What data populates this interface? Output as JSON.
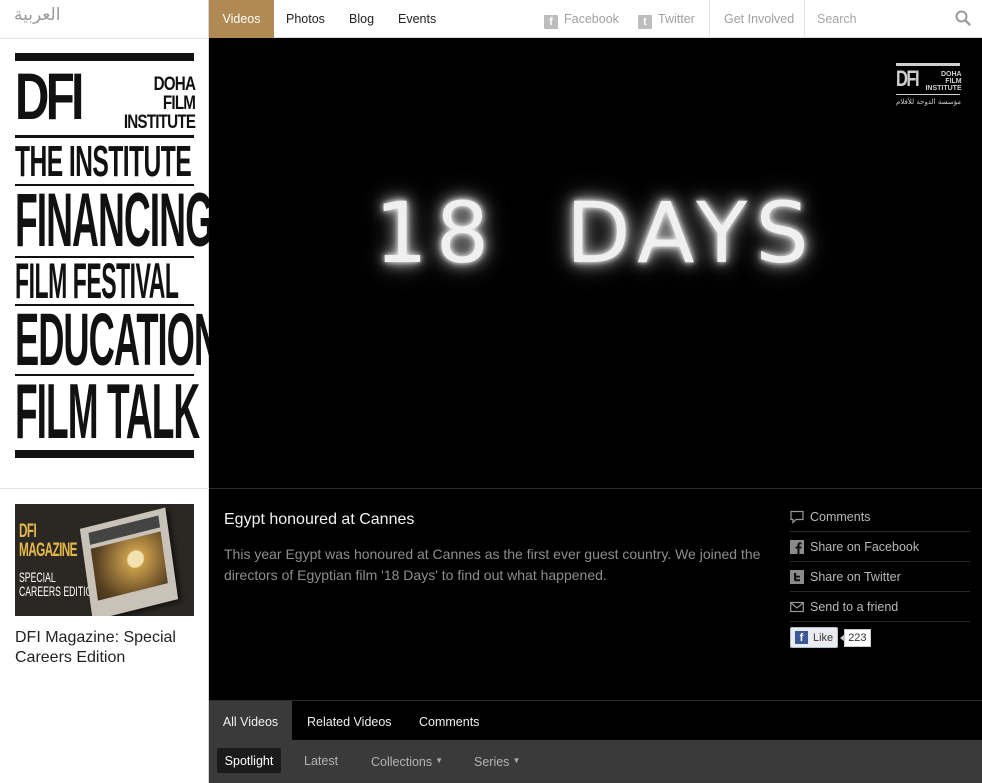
{
  "language_switch": "العربية",
  "logo": {
    "main": "DFI",
    "side_lines": [
      "DOHA",
      "FILM",
      "INSTITUTE"
    ]
  },
  "sidebar_nav": [
    {
      "label": "THE INSTITUTE"
    },
    {
      "label": "FINANCING"
    },
    {
      "label": "FILM FESTIVAL"
    },
    {
      "label": "EDUCATION"
    },
    {
      "label": "FILM TALK"
    }
  ],
  "magazine": {
    "cover_title_line1": "DFI",
    "cover_title_line2": "MAGAZINE",
    "cover_sub_line1": "SPECIAL",
    "cover_sub_line2": "CAREERS EDITION",
    "caption": "DFI Magazine: Special Careers Edition"
  },
  "topbar": {
    "tabs": [
      {
        "label": "Videos",
        "active": true
      },
      {
        "label": "Photos",
        "active": false
      },
      {
        "label": "Blog",
        "active": false
      },
      {
        "label": "Events",
        "active": false
      }
    ],
    "facebook": "Facebook",
    "twitter": "Twitter",
    "get_involved": "Get Involved",
    "search_placeholder": "Search"
  },
  "video": {
    "title_text": "18 DAYS",
    "watermark": {
      "main": "DFI",
      "side_lines": [
        "DOHA",
        "FILM",
        "INSTITUTE"
      ],
      "arabic": "مؤسسة الدوحة للأفلام"
    }
  },
  "info": {
    "title": "Egypt honoured at Cannes",
    "description": "This year Egypt was honoured at Cannes as the first ever guest country. We joined the directors of Egyptian film '18 Days' to find out what happened.",
    "actions": [
      {
        "label": "Comments",
        "icon": "comment-icon"
      },
      {
        "label": "Share on Facebook",
        "icon": "facebook-icon"
      },
      {
        "label": "Share on Twitter",
        "icon": "twitter-icon"
      },
      {
        "label": "Send to a friend",
        "icon": "mail-icon"
      }
    ],
    "like_label": "Like",
    "like_count": "223"
  },
  "bottom_tabs": [
    {
      "label": "All Videos",
      "active": true
    },
    {
      "label": "Related Videos",
      "active": false
    },
    {
      "label": "Comments",
      "active": false
    }
  ],
  "sub_tabs": [
    {
      "label": "Spotlight",
      "active": true,
      "dropdown": false
    },
    {
      "label": "Latest",
      "active": false,
      "dropdown": false
    },
    {
      "label": "Collections",
      "active": false,
      "dropdown": true
    },
    {
      "label": "Series",
      "active": false,
      "dropdown": true
    }
  ],
  "colors": {
    "accent": "#b08a52",
    "dark_bg": "#000000",
    "subbar_bg": "#3a3a3a",
    "facebook_blue": "#3b5998"
  }
}
